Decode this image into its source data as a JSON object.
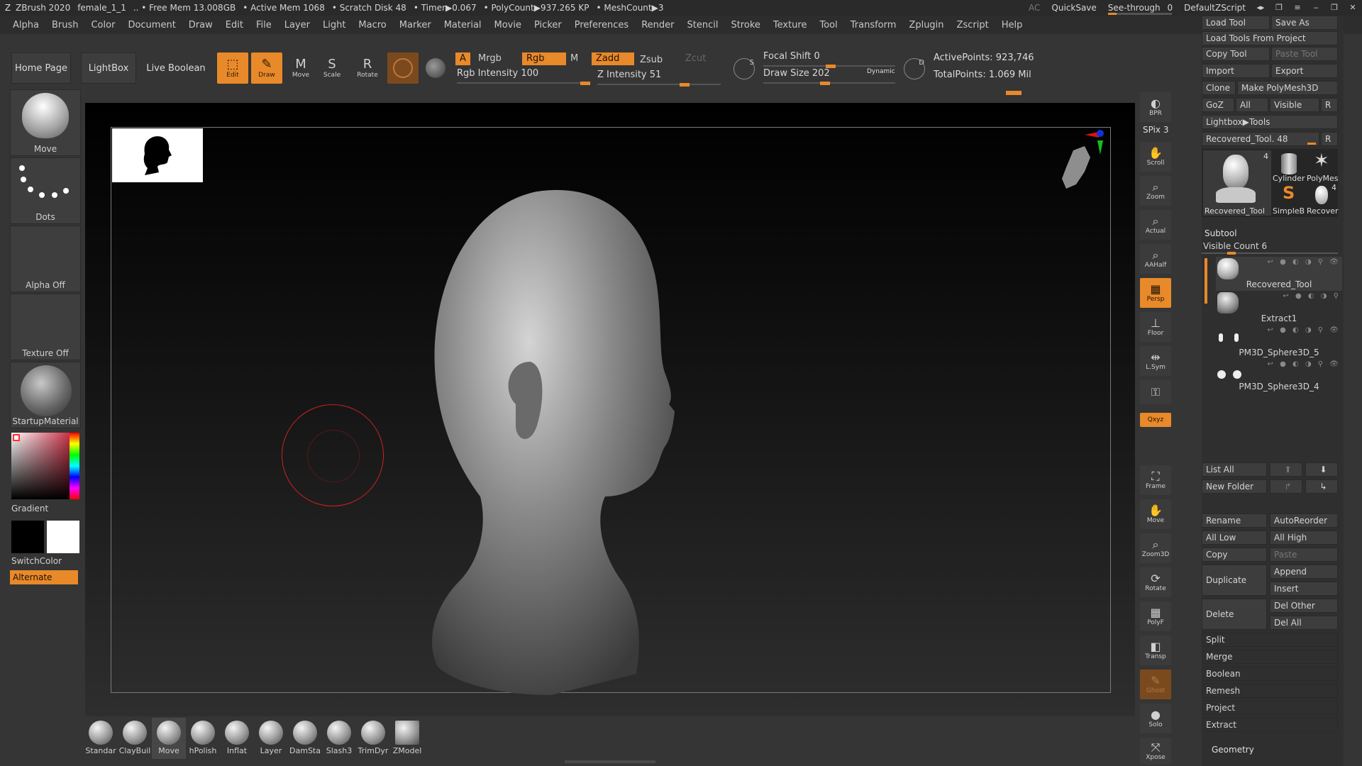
{
  "titlebar": {
    "app": "ZBrush 2020",
    "document": "female_1_1",
    "stats": [
      ".. • Free Mem 13.008GB",
      "• Active Mem 1068",
      "• Scratch Disk 48",
      "• Timer▶0.067",
      "• PolyCount▶937.265 KP",
      "• MeshCount▶3"
    ],
    "ac": "AC",
    "quicksave": "QuickSave",
    "see_through_label": "See-through",
    "see_through_value": "0",
    "default_zscript": "DefaultZScript"
  },
  "menu": [
    "Alpha",
    "Brush",
    "Color",
    "Document",
    "Draw",
    "Edit",
    "File",
    "Layer",
    "Light",
    "Macro",
    "Marker",
    "Material",
    "Movie",
    "Picker",
    "Preferences",
    "Render",
    "Stencil",
    "Stroke",
    "Texture",
    "Tool",
    "Transform",
    "Zplugin",
    "Zscript",
    "Help"
  ],
  "shelf": {
    "home": "Home Page",
    "lightbox": "LightBox",
    "live_boolean": "Live Boolean"
  },
  "transform_tools": [
    {
      "label": "Edit",
      "active": true,
      "icon": "edit-icon",
      "glyph": "⬚"
    },
    {
      "label": "Draw",
      "active": true,
      "icon": "draw-icon",
      "glyph": "✎"
    },
    {
      "label": "Move",
      "active": false,
      "icon": "move-icon",
      "glyph": "M"
    },
    {
      "label": "Scale",
      "active": false,
      "icon": "scale-icon",
      "glyph": "S"
    },
    {
      "label": "Rotate",
      "active": false,
      "icon": "rotate-icon",
      "glyph": "R"
    }
  ],
  "color_toggles": {
    "a": "A",
    "mrgb": "Mrgb",
    "rgb": "Rgb",
    "m": "M",
    "zadd": "Zadd",
    "zsub": "Zsub",
    "zcut": "Zcut"
  },
  "sliders": {
    "rgb_intensity": {
      "label": "Rgb Intensity 100",
      "value": 100
    },
    "z_intensity": {
      "label": "Z Intensity 51",
      "value": 51
    },
    "focal_shift": {
      "label": "Focal Shift 0",
      "value": 0
    },
    "draw_size": {
      "label": "Draw Size 202",
      "value": 202
    },
    "dynamic": "Dynamic"
  },
  "stats": {
    "active_points": "ActivePoints: 923,746",
    "total_points": "TotalPoints: 1.069 Mil"
  },
  "left_panel": {
    "brush": "Move",
    "stroke": "Dots",
    "alpha": "Alpha Off",
    "texture": "Texture Off",
    "material": "StartupMaterial",
    "gradient": "Gradient",
    "switchcolor": "SwitchColor",
    "alternate": "Alternate"
  },
  "brush_shelf": [
    {
      "name": "Standar",
      "selected": false
    },
    {
      "name": "ClayBuil",
      "selected": false
    },
    {
      "name": "Move",
      "selected": true
    },
    {
      "name": "hPolish",
      "selected": false
    },
    {
      "name": "Inflat",
      "selected": false
    },
    {
      "name": "Layer",
      "selected": false
    },
    {
      "name": "DamSta",
      "selected": false
    },
    {
      "name": "Slash3",
      "selected": false
    },
    {
      "name": "TrimDyr",
      "selected": false
    },
    {
      "name": "ZModel",
      "selected": false
    }
  ],
  "right_vbar": [
    {
      "label": "BPR",
      "icon": "bpr-icon",
      "glyph": "◐",
      "state": "normal"
    },
    {
      "label": "SPix 3",
      "icon": "spix-icon",
      "glyph": "",
      "state": "text"
    },
    {
      "label": "Scroll",
      "icon": "scroll-icon",
      "glyph": "✋",
      "state": "normal"
    },
    {
      "label": "Zoom",
      "icon": "zoom-icon",
      "glyph": "⌕",
      "state": "normal"
    },
    {
      "label": "Actual",
      "icon": "actual-icon",
      "glyph": "⌕",
      "state": "normal"
    },
    {
      "label": "AAHalf",
      "icon": "aahalf-icon",
      "glyph": "⌕",
      "state": "normal"
    },
    {
      "label": "Persp",
      "icon": "persp-icon",
      "glyph": "▦",
      "state": "on"
    },
    {
      "label": "Floor",
      "icon": "floor-icon",
      "glyph": "⊥",
      "state": "normal"
    },
    {
      "label": "L.Sym",
      "icon": "lsym-icon",
      "glyph": "⇹",
      "state": "normal"
    },
    {
      "label": "",
      "icon": "lock-icon",
      "glyph": "🔒",
      "state": "normal"
    },
    {
      "label": "Qxyz",
      "icon": "xyz-icon",
      "glyph": "",
      "state": "on-small"
    },
    {
      "label": "Frame",
      "icon": "frame-icon",
      "glyph": "⛶",
      "state": "normal"
    },
    {
      "label": "Move",
      "icon": "move-view-icon",
      "glyph": "✋",
      "state": "normal"
    },
    {
      "label": "Zoom3D",
      "icon": "zoom3d-icon",
      "glyph": "⌕",
      "state": "normal"
    },
    {
      "label": "Rotate",
      "icon": "rotate-view-icon",
      "glyph": "⟳",
      "state": "normal"
    },
    {
      "label": "PolyF",
      "icon": "polyf-icon",
      "glyph": "▦",
      "state": "normal"
    },
    {
      "label": "Transp",
      "icon": "transp-icon",
      "glyph": "◧",
      "state": "normal"
    },
    {
      "label": "Ghost",
      "icon": "ghost-icon",
      "glyph": "✎",
      "state": "dim"
    },
    {
      "label": "Solo",
      "icon": "solo-icon",
      "glyph": "●",
      "state": "normal"
    },
    {
      "label": "Xpose",
      "icon": "xpose-icon",
      "glyph": "⤧",
      "state": "normal"
    }
  ],
  "right_panel": {
    "load_tool": "Load Tool",
    "save_as": "Save As",
    "load_tools_from_project": "Load Tools From Project",
    "copy_tool": "Copy Tool",
    "paste_tool": "Paste Tool",
    "import": "Import",
    "export": "Export",
    "clone": "Clone",
    "make_polymesh": "Make PolyMesh3D",
    "goz": "GoZ",
    "all": "All",
    "visible": "Visible",
    "r": "R",
    "lightbox_tools": "Lightbox▶Tools",
    "recovered_tool_slider": "Recovered_Tool. 48",
    "tool_thumbs": [
      {
        "name": "Recovered_Tool",
        "count": "4"
      },
      {
        "name": "Cylinder",
        "count": ""
      },
      {
        "name": "PolyMes",
        "count": ""
      },
      {
        "name": "SimpleB",
        "count": ""
      },
      {
        "name": "Recover",
        "count": "4"
      }
    ],
    "subtool_header": "Subtool",
    "visible_count": "Visible Count 6",
    "subtools": [
      {
        "name": "Recovered_Tool",
        "selected": true
      },
      {
        "name": "Extract1",
        "selected": false
      },
      {
        "name": "PM3D_Sphere3D_5",
        "selected": false
      },
      {
        "name": "PM3D_Sphere3D_4",
        "selected": false
      }
    ],
    "list_all": "List All",
    "new_folder": "New Folder",
    "rename": "Rename",
    "autoreorder": "AutoReorder",
    "all_low": "All Low",
    "all_high": "All High",
    "copy": "Copy",
    "paste": "Paste",
    "duplicate": "Duplicate",
    "append": "Append",
    "insert": "Insert",
    "delete": "Delete",
    "del_other": "Del Other",
    "del_all": "Del All",
    "split": "Split",
    "merge": "Merge",
    "boolean": "Boolean",
    "remesh": "Remesh",
    "project": "Project",
    "extract": "Extract",
    "geometry": "Geometry"
  },
  "colors": {
    "accent": "#e8892a",
    "background": "#353535",
    "panel": "#2f2f2f"
  }
}
